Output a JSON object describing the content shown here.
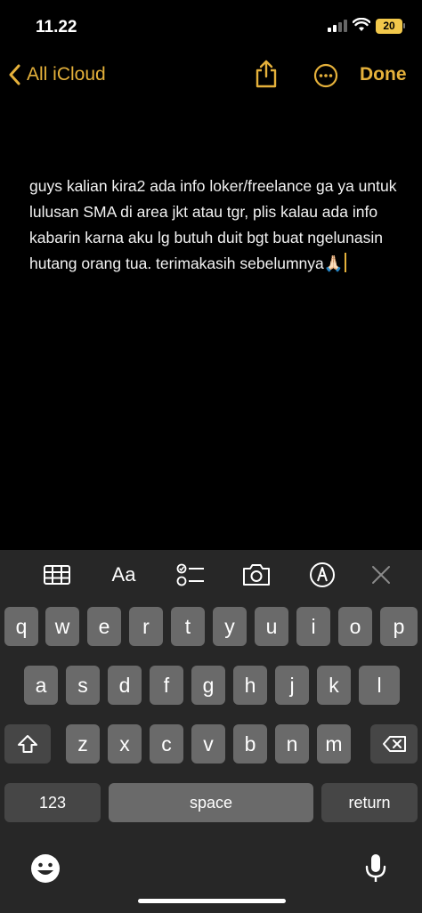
{
  "status": {
    "time": "11.22",
    "battery": "20"
  },
  "nav": {
    "back_label": "All iCloud",
    "done_label": "Done"
  },
  "note": {
    "text": "guys kalian kira2 ada info loker/freelance ga ya untuk lulusan SMA di area jkt atau tgr, plis kalau ada info kabarin karna aku lg butuh duit bgt buat ngelunasin hutang orang tua. terimakasih sebelumnya🙏🏻"
  },
  "toolbar": {
    "format_label": "Aa"
  },
  "keyboard": {
    "row1": [
      "q",
      "w",
      "e",
      "r",
      "t",
      "y",
      "u",
      "i",
      "o",
      "p"
    ],
    "row2": [
      "a",
      "s",
      "d",
      "f",
      "g",
      "h",
      "j",
      "k",
      "l"
    ],
    "row3": [
      "z",
      "x",
      "c",
      "v",
      "b",
      "n",
      "m"
    ],
    "numbers_label": "123",
    "space_label": "space",
    "return_label": "return"
  },
  "colors": {
    "accent": "#e5b13b",
    "background": "#000000",
    "keyboard_bg": "#272727",
    "key": "#6a6a6a"
  }
}
